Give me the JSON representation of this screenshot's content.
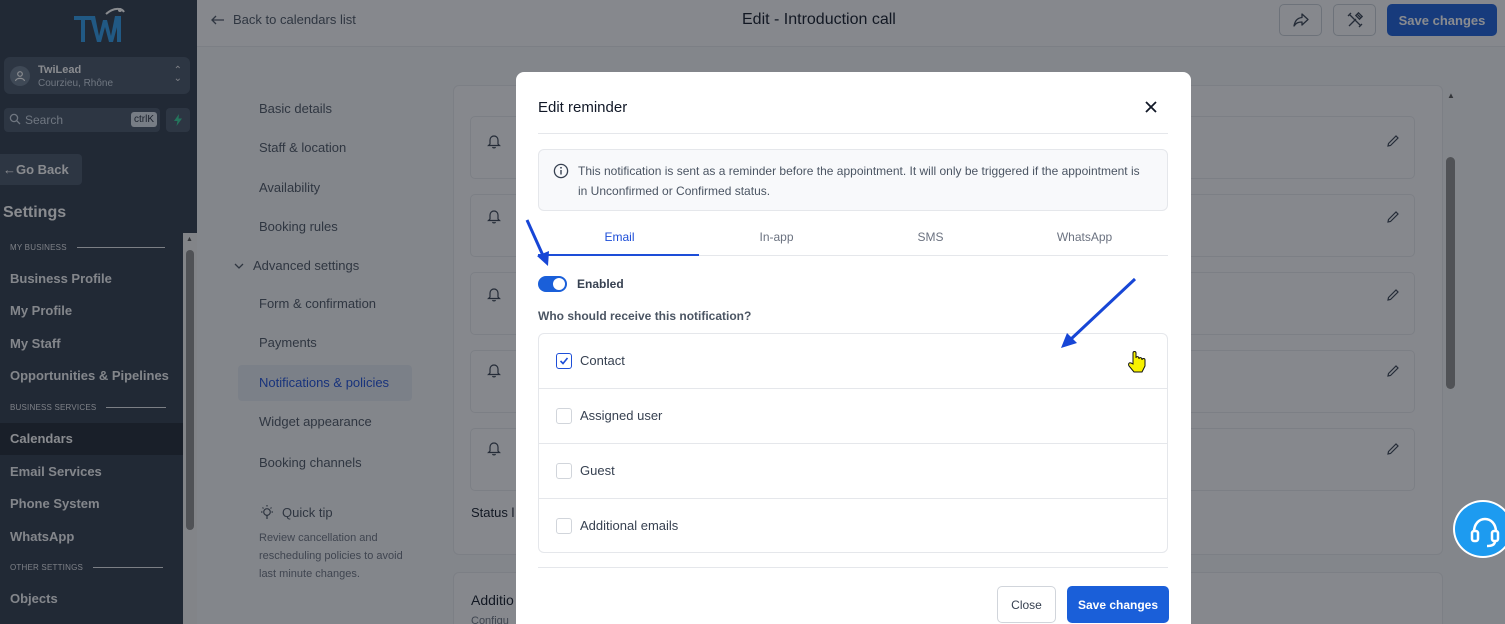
{
  "brand": {
    "logo_text": "TWI",
    "accent": "#1a5fd9"
  },
  "sidebar": {
    "location": {
      "name": "TwiLead",
      "address": "Courzieu, Rhône"
    },
    "search": {
      "placeholder": "Search",
      "shortcut": "ctrlK"
    },
    "go_back": "Go Back",
    "title": "Settings",
    "sections": {
      "my_business": "MY BUSINESS",
      "business_services": "BUSINESS SERVICES",
      "other_settings": "OTHER SETTINGS"
    },
    "items": [
      {
        "label": "Business Profile"
      },
      {
        "label": "My Profile"
      },
      {
        "label": "My Staff"
      },
      {
        "label": "Opportunities & Pipelines"
      },
      {
        "label": "Calendars",
        "active": true
      },
      {
        "label": "Email Services"
      },
      {
        "label": "Phone System"
      },
      {
        "label": "WhatsApp"
      },
      {
        "label": "Objects"
      }
    ]
  },
  "topbar": {
    "back_label": "Back to calendars list",
    "title": "Edit - Introduction call",
    "save_label": "Save changes"
  },
  "subnav": {
    "items": [
      "Basic details",
      "Staff & location",
      "Availability",
      "Booking rules",
      "Advanced settings",
      "Form & confirmation",
      "Payments",
      "Notifications & policies",
      "Widget appearance",
      "Booking channels"
    ],
    "active": "Notifications & policies",
    "quick_tip_title": "Quick tip",
    "quick_tip_text": "Review cancellation and rescheduling policies to avoid last minute changes."
  },
  "content": {
    "status_label": "Status l",
    "card2_title": "Additio",
    "card2_sub": "Configu"
  },
  "modal": {
    "title": "Edit reminder",
    "info": "This notification is sent as a reminder before the appointment. It will only be triggered if the appointment is in Unconfirmed or Confirmed status.",
    "tabs": [
      "Email",
      "In-app",
      "SMS",
      "WhatsApp"
    ],
    "active_tab": "Email",
    "enabled_label": "Enabled",
    "enabled": true,
    "who_label": "Who should receive this notification?",
    "recipients": [
      {
        "label": "Contact",
        "checked": true
      },
      {
        "label": "Assigned user",
        "checked": false
      },
      {
        "label": "Guest",
        "checked": false
      },
      {
        "label": "Additional emails",
        "checked": false
      }
    ],
    "close_label": "Close",
    "save_label": "Save changes"
  }
}
